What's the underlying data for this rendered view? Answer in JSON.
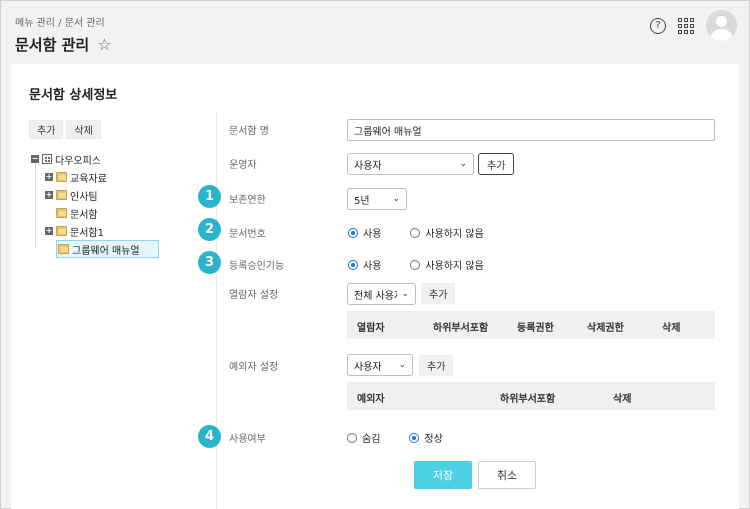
{
  "header": {
    "breadcrumb": "메뉴 관리 / 문서 관리",
    "title": "문서함 관리"
  },
  "panel": {
    "title": "문서함 상세정보"
  },
  "tree": {
    "add_label": "추가",
    "delete_label": "삭제",
    "nodes": [
      {
        "label": "다우오피스"
      },
      {
        "label": "교육자료"
      },
      {
        "label": "인사팀"
      },
      {
        "label": "문서함"
      },
      {
        "label": "문서함1"
      },
      {
        "label": "그룹웨어 매뉴얼"
      }
    ]
  },
  "badges": [
    "1",
    "2",
    "3",
    "4"
  ],
  "form": {
    "name": {
      "label": "문서함 명",
      "value": "그룹웨어 매뉴얼"
    },
    "operator": {
      "label": "운영자",
      "value": "사용자",
      "add_label": "추가"
    },
    "retention": {
      "label": "보존연한",
      "value": "5년"
    },
    "doc_number": {
      "label": "문서번호",
      "on_label": "사용",
      "off_label": "사용하지 않음"
    },
    "approval": {
      "label": "등록승인기능",
      "on_label": "사용",
      "off_label": "사용하지 않음"
    },
    "viewer": {
      "label": "열람자 설정",
      "value": "전체 사용자",
      "add_label": "추가",
      "columns": [
        "열람자",
        "하위부서포함",
        "등록권한",
        "삭제권한",
        "삭제"
      ]
    },
    "exception": {
      "label": "예외자 설정",
      "value": "사용자",
      "add_label": "추가",
      "columns": [
        "예외자",
        "하위부서포함",
        "삭제"
      ]
    },
    "usage": {
      "label": "사용여부",
      "hidden_label": "숨김",
      "normal_label": "정상"
    }
  },
  "actions": {
    "save_label": "저장",
    "cancel_label": "취소"
  },
  "colors": {
    "accent": "#4dd0e1",
    "badge": "#29b4cc",
    "radio": "#1a73e8"
  }
}
